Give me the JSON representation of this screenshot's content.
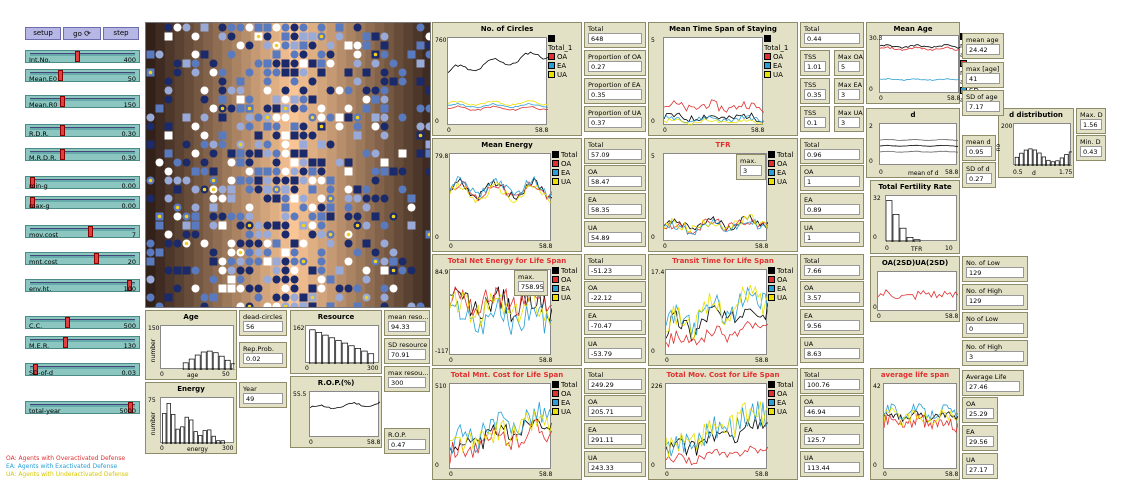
{
  "buttons": {
    "setup": "setup",
    "go": "go",
    "step": "step"
  },
  "sliders": [
    {
      "name": "Int.No.",
      "value": "400",
      "knob": 0.45
    },
    {
      "name": "Mean.E0",
      "value": "50",
      "knob": 0.28
    },
    {
      "name": "Mean.R0",
      "value": "150",
      "knob": 0.3
    },
    {
      "name": "R.D.R.",
      "value": "0.30",
      "knob": 0.3
    },
    {
      "name": "M.R.D.R.",
      "value": "0.30",
      "knob": 0.3
    },
    {
      "name": "min-g",
      "value": "0.00",
      "knob": 0.0
    },
    {
      "name": "max-g",
      "value": "0.00",
      "knob": 0.0
    },
    {
      "name": "mov.cost",
      "value": "7",
      "knob": 0.58
    },
    {
      "name": "mnt.cost",
      "value": "20",
      "knob": 0.64
    },
    {
      "name": "env.ht.",
      "value": "100",
      "knob": 0.97
    },
    {
      "name": "C.C.",
      "value": "500",
      "knob": 0.35
    },
    {
      "name": "M.E.R.",
      "value": "130",
      "knob": 0.33
    },
    {
      "name": "SD-of-d",
      "value": "0.03",
      "knob": 0.03
    },
    {
      "name": "total-year",
      "value": "5000",
      "knob": 0.98
    }
  ],
  "legend_notes": [
    {
      "text": "OA: Agents with Overactivated Defense",
      "color": "#e03030"
    },
    {
      "text": "EA: Agents with Exactivated Defense",
      "color": "#2a9fd6"
    },
    {
      "text": "UA: Agents with Underactivated Defense",
      "color": "#d8c800"
    }
  ],
  "colors": {
    "total": "#000000",
    "oa": "#e03030",
    "ea": "#2a9fd6",
    "ua": "#e8e000"
  },
  "monitors": {
    "dead_circles": {
      "label": "dead-circles",
      "value": "56"
    },
    "rep_prob": {
      "label": "Rep.Prob.",
      "value": "0.02"
    },
    "year": {
      "label": "Year",
      "value": "49"
    },
    "mean_reso": {
      "label": "mean reso...",
      "value": "94.33"
    },
    "sd_resource": {
      "label": "SD resource",
      "value": "70.91"
    },
    "max_resou": {
      "label": "max resou...",
      "value": "300"
    },
    "rop": {
      "label": "R.O.P.",
      "value": "0.47"
    },
    "total_circles": {
      "label": "Total",
      "value": "648"
    },
    "prop_oa": {
      "label": "Proportion of OA",
      "value": "0.27"
    },
    "prop_ea": {
      "label": "Proportion of EA",
      "value": "0.35"
    },
    "prop_ua": {
      "label": "Proportion of UA",
      "value": "0.37"
    },
    "tss_total": {
      "label": "Total",
      "value": "0.44"
    },
    "tss_oa": {
      "label": "TSS of...",
      "value": "1.01"
    },
    "tss_ea": {
      "label": "TSS of...",
      "value": "0.35"
    },
    "tss_ua": {
      "label": "TSS of...",
      "value": "0.1"
    },
    "max_oa": {
      "label": "Max OA",
      "value": "5"
    },
    "max_ea": {
      "label": "Max EA",
      "value": "3"
    },
    "max_ua": {
      "label": "Max UA",
      "value": "3"
    },
    "mean_age": {
      "label": "mean age",
      "value": "24.42"
    },
    "max_age": {
      "label": "max [age]",
      "value": "41"
    },
    "sd_age": {
      "label": "SD of age",
      "value": "7.17"
    },
    "mean_d": {
      "label": "mean d",
      "value": "0.95"
    },
    "sd_d": {
      "label": "SD of d",
      "value": "0.27"
    },
    "max_d": {
      "label": "Max. D",
      "value": "1.56"
    },
    "min_d": {
      "label": "Min. D",
      "value": "0.43"
    },
    "energy_total": {
      "label": "Total",
      "value": "57.09"
    },
    "energy_oa": {
      "label": "OA",
      "value": "58.47"
    },
    "energy_ea": {
      "label": "EA",
      "value": "58.35"
    },
    "energy_ua": {
      "label": "UA",
      "value": "54.89"
    },
    "tfr_total": {
      "label": "Total",
      "value": "0.96"
    },
    "tfr_oa": {
      "label": "OA",
      "value": "1"
    },
    "tfr_ea": {
      "label": "EA",
      "value": "0.89"
    },
    "tfr_ua": {
      "label": "UA",
      "value": "1"
    },
    "tfr_max": {
      "label": "max.",
      "value": "3"
    },
    "net_total": {
      "label": "Total",
      "value": "-51.23"
    },
    "net_oa": {
      "label": "OA",
      "value": "-22.12"
    },
    "net_ea": {
      "label": "EA",
      "value": "-70.47"
    },
    "net_ua": {
      "label": "UA",
      "value": "-53.79"
    },
    "net_max": {
      "label": "max.",
      "value": "758.95"
    },
    "tt_total": {
      "label": "Total",
      "value": "7.66"
    },
    "tt_oa": {
      "label": "OA",
      "value": "3.57"
    },
    "tt_ea": {
      "label": "EA",
      "value": "9.56"
    },
    "tt_ua": {
      "label": "UA",
      "value": "8.63"
    },
    "low_d": {
      "label": "No. of Low D(<1SD)",
      "value": "129"
    },
    "high_d": {
      "label": "No. of High D(>1SD)",
      "value": "129"
    },
    "low_d2": {
      "label": "No of Low D(<2SD)",
      "value": "0"
    },
    "high_d2": {
      "label": "No. of High D(>2SD)",
      "value": "3"
    },
    "mnt_total": {
      "label": "Total",
      "value": "249.29"
    },
    "mnt_oa": {
      "label": "OA",
      "value": "205.71"
    },
    "mnt_ea": {
      "label": "EA",
      "value": "291.11"
    },
    "mnt_ua": {
      "label": "UA",
      "value": "243.33"
    },
    "mov_total": {
      "label": "Total",
      "value": "100.76"
    },
    "mov_oa": {
      "label": "OA",
      "value": "46.94"
    },
    "mov_ea": {
      "label": "EA",
      "value": "125.7"
    },
    "mov_ua": {
      "label": "UA",
      "value": "113.44"
    },
    "avg_ls": {
      "label": "Average Life Span",
      "value": "27.46"
    },
    "ls_oa": {
      "label": "OA",
      "value": "25.29"
    },
    "ls_ea": {
      "label": "EA",
      "value": "29.56"
    },
    "ls_ua": {
      "label": "UA",
      "value": "27.17"
    }
  },
  "plots": {
    "age": {
      "title": "Age",
      "ymax": "150",
      "xmin": "0",
      "xmax": "50",
      "xlabel": "age",
      "ylabel": "number"
    },
    "energy": {
      "title": "Energy",
      "ymax": "75",
      "xmin": "0",
      "xmax": "300",
      "xlabel": "energy",
      "ylabel": "number"
    },
    "resource": {
      "title": "Resource",
      "ymax": "162",
      "xmin": "0",
      "xmax": "300"
    },
    "rop": {
      "title": "R.O.P.(%)",
      "ymax": "55.5",
      "xmin": "0",
      "xmax": "58.8"
    },
    "circles": {
      "title": "No. of Circles",
      "ymax": "760",
      "ymin": "0",
      "xmin": "0",
      "xmax": "58.8"
    },
    "tss": {
      "title": "Mean Time Span of Staying",
      "ymax": "5",
      "ymin": "0",
      "xmin": "0",
      "xmax": "58.8"
    },
    "meanage": {
      "title": "Mean Age",
      "ymax": "30.3",
      "ymin": "0",
      "xmin": "0",
      "xmax": "58.8"
    },
    "d": {
      "title": "d",
      "ymax": "2",
      "ymin": "0",
      "xmin": "0",
      "xmax": "58.8",
      "xlabel": "mean of d"
    },
    "ddist": {
      "title": "d distribution",
      "ymax": "200",
      "xmin": "0.5",
      "xmax": "1.75",
      "xlabel": "d",
      "ylabel": "no"
    },
    "menergy": {
      "title": "Mean Energy",
      "ymax": "79.8",
      "ymin": "0",
      "xmin": "0",
      "xmax": "58.8"
    },
    "tfr": {
      "title": "TFR",
      "ymax": "5",
      "ymin": "0",
      "xmin": "0",
      "xmax": "58.8"
    },
    "tfrate": {
      "title": "Total Fertility Rate",
      "ymax": "32",
      "ymin": "0",
      "xmin": "0",
      "xmax": "10",
      "xlabel": "TFR"
    },
    "net": {
      "title": "Total Net  Energy for Life Span",
      "ymax": "84.9",
      "ymin": "-117",
      "xmin": "0",
      "xmax": "58.8"
    },
    "transit": {
      "title": "Transit Time for Life Span",
      "ymax": "17.4",
      "ymin": "0",
      "xmin": "0",
      "xmax": "58.8"
    },
    "oaua": {
      "title": "OA(2SD)UA(2SD)",
      "ymax": "",
      "ymin": "0",
      "xmin": "0",
      "xmax": "58.8"
    },
    "mnt": {
      "title": "Total Mnt. Cost for Life Span",
      "ymax": "510",
      "ymin": "0",
      "xmin": "0",
      "xmax": "58.8"
    },
    "mov": {
      "title": "Total Mov. Cost for Life Span",
      "ymax": "226",
      "ymin": "0",
      "xmin": "0",
      "xmax": "58.8"
    },
    "avgls": {
      "title": "average life span",
      "ymax": "42",
      "ymin": "0",
      "xmin": "0",
      "xmax": "58.8"
    }
  },
  "legend4": [
    "Total",
    "OA",
    "EA",
    "UA"
  ],
  "legend4b": [
    "Total_1",
    "OA",
    "EA",
    "UA"
  ],
  "legend_age": [
    "mean age",
    "median age",
    "SD age"
  ]
}
